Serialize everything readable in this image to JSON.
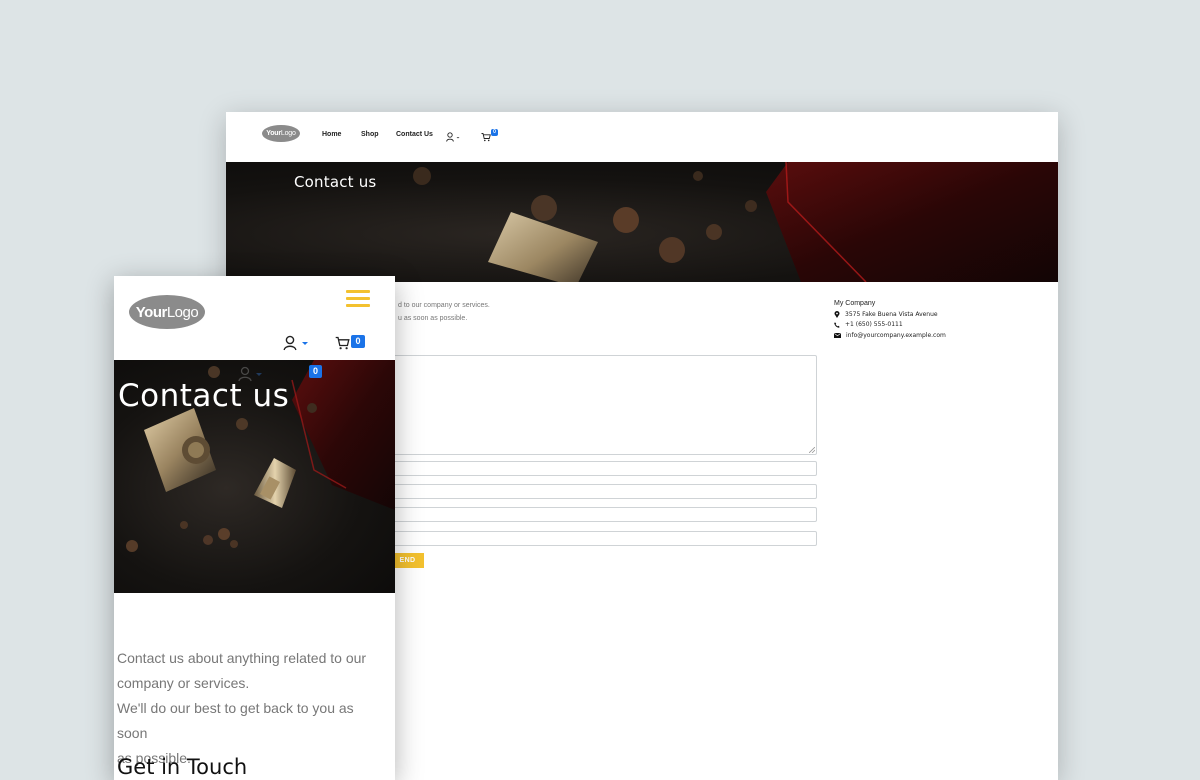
{
  "desktop": {
    "logo": {
      "bold": "Your",
      "light": "Logo"
    },
    "nav": {
      "home": "Home",
      "shop": "Shop",
      "contact": "Contact Us"
    },
    "cart_count": "0",
    "hero_title": "Contact us",
    "intro_line1": "d to our company or services.",
    "intro_line2": "u as soon as possible.",
    "send_label": "END",
    "company": {
      "name": "My Company",
      "address": "3575 Fake Buena Vista Avenue",
      "phone": "+1 (650) 555-0111",
      "email": "info@yourcompany.example.com"
    }
  },
  "mobile": {
    "logo": {
      "bold": "Your",
      "light": "Logo"
    },
    "cart_count": "0",
    "hero_title": "Contact us",
    "ghost_cart_count": "0",
    "intro": "Contact us about anything related to our company or services. We'll do our best to get back to you as soon as possible.",
    "intro_line1": "Contact us about anything related to our",
    "intro_line2": "company or services.",
    "intro_line3": "We'll do our best to get back to you as soon",
    "intro_line4": "as possible.",
    "section_title": "Get in Touch"
  },
  "colors": {
    "accent": "#f3c12f",
    "badge": "#1a73e8",
    "backdrop": "#dde4e6"
  },
  "icons": [
    "user-icon",
    "cart-icon",
    "hamburger-menu-icon",
    "map-marker-icon",
    "phone-icon",
    "envelope-icon",
    "chevron-down-icon"
  ]
}
